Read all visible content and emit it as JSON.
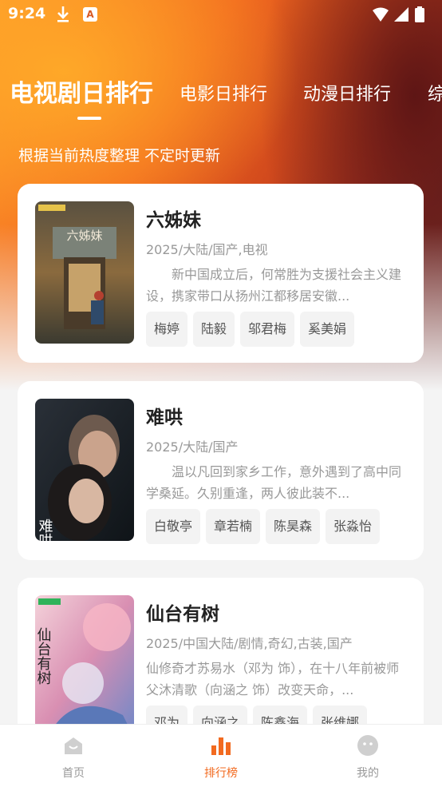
{
  "status_bar": {
    "time": "9:24"
  },
  "tabs": [
    {
      "label": "电视剧日排行",
      "active": true
    },
    {
      "label": "电影日排行",
      "active": false
    },
    {
      "label": "动漫日排行",
      "active": false
    },
    {
      "label": "综",
      "active": false
    }
  ],
  "subtitle": "根据当前热度整理 不定时更新",
  "colors": {
    "accent": "#f26a1f",
    "hero_start": "#ff9a2a",
    "hero_end": "#6a2624"
  },
  "items": [
    {
      "title": "六姊妹",
      "meta": "2025/大陆/国产,电视",
      "desc": "新中国成立后，何常胜为支援社会主义建设，携家带口从扬州江都移居安徽...",
      "tags": [
        "梅婷",
        "陆毅",
        "邬君梅",
        "奚美娟"
      ]
    },
    {
      "title": "难哄",
      "meta": "2025/大陆/国产",
      "desc": "温以凡回到家乡工作，意外遇到了高中同学桑延。久别重逢，两人彼此装不...",
      "tags": [
        "白敬亭",
        "章若楠",
        "陈昊森",
        "张淼怡"
      ]
    },
    {
      "title": "仙台有树",
      "meta": "2025/中国大陆/剧情,奇幻,古装,国产",
      "desc": "仙修奇才苏易水（邓为 饰），在十八年前被师父沐清歌（向涵之 饰）改变天命，...",
      "tags": [
        "邓为",
        "向涵之",
        "陈鑫海",
        "张维娜"
      ]
    }
  ],
  "bottom_nav": [
    {
      "label": "首页",
      "icon": "home-icon",
      "active": false
    },
    {
      "label": "排行榜",
      "icon": "chart-icon",
      "active": true
    },
    {
      "label": "我的",
      "icon": "profile-icon",
      "active": false
    }
  ]
}
